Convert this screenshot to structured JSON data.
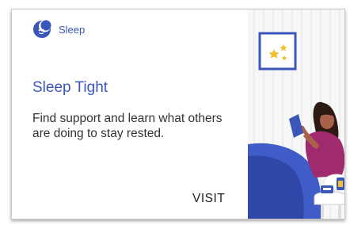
{
  "card": {
    "brand_label": "Sleep",
    "brand_icon": "moon-face-icon",
    "title": "Sleep Tight",
    "description": "Find support and learn what others are doing to stay rested.",
    "action_label": "VISIT"
  },
  "colors": {
    "accent": "#3b56b9",
    "text": "#333333",
    "frame_gold": "#f0c030",
    "blanket": "#3f5cc8",
    "shirt": "#a02a6e",
    "skin": "#a8614a",
    "hair": "#2e1a14"
  }
}
